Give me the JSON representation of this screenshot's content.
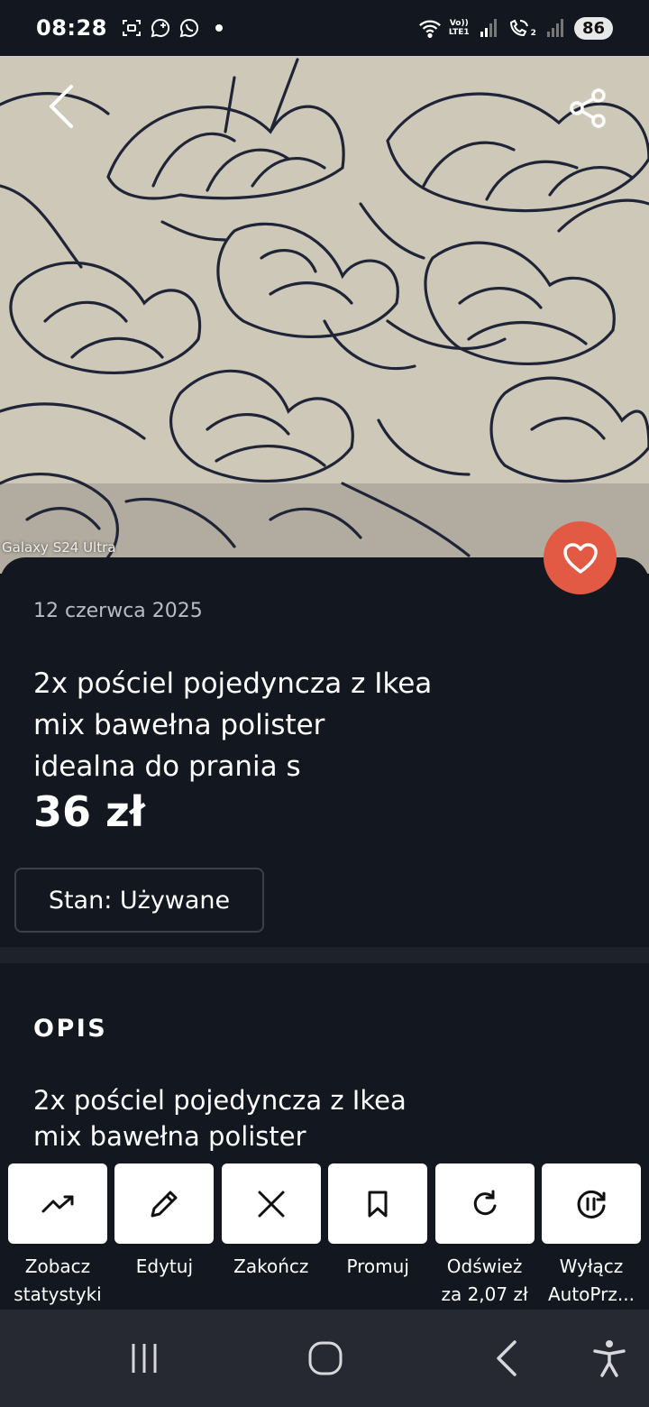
{
  "status_bar": {
    "time": "08:28",
    "battery": "86",
    "network_label_top": "Vo))",
    "network_label_bottom": "LTE1",
    "sim2_label": "2"
  },
  "photo": {
    "watermark": "Galaxy S24 Ultra"
  },
  "listing": {
    "date": "12 czerwca 2025",
    "title_lines": [
      "2x pościel pojedyncza z Ikea",
      "mix bawełna polister",
      "idealna do prania s"
    ],
    "price": "36 zł",
    "state": "Stan: Używane"
  },
  "description": {
    "heading": "OPIS",
    "lines": [
      "2x pościel pojedyncza z Ikea",
      "mix bawełna polister"
    ]
  },
  "actions": [
    {
      "icon": "trending-up-icon",
      "line1": "Zobacz",
      "line2": "statystyki"
    },
    {
      "icon": "pencil-icon",
      "line1": "Edytuj",
      "line2": ""
    },
    {
      "icon": "close-icon",
      "line1": "Zakończ",
      "line2": ""
    },
    {
      "icon": "bookmark-icon",
      "line1": "Promuj",
      "line2": ""
    },
    {
      "icon": "refresh-icon",
      "line1": "Odśwież",
      "line2": "za 2,07 zł"
    },
    {
      "icon": "pause-refresh-icon",
      "line1": "Wyłącz",
      "line2": "AutoPrz..."
    }
  ],
  "colors": {
    "background": "#13171f",
    "favorite": "#e25a44",
    "navbar": "#262932"
  }
}
